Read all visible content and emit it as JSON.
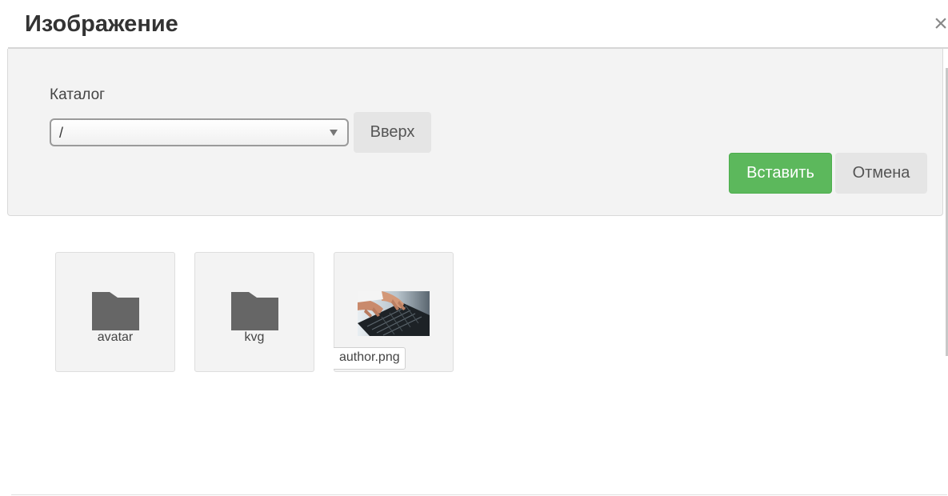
{
  "dialog": {
    "title": "Изображение",
    "close_label": "×"
  },
  "toolbar": {
    "catalog_label": "Каталог",
    "catalog_value": "/",
    "up_label": "Вверх",
    "insert_label": "Вставить",
    "cancel_label": "Отмена"
  },
  "files": [
    {
      "name": "avatar",
      "type": "folder",
      "icon": "folder-icon"
    },
    {
      "name": "kvg",
      "type": "folder",
      "icon": "folder-icon"
    },
    {
      "name": "author.png",
      "type": "image",
      "icon": "image-thumbnail"
    }
  ],
  "colors": {
    "insert_button": "#5cb85c",
    "toolbar_bg": "#f3f3f3",
    "folder_icon": "#666666"
  }
}
